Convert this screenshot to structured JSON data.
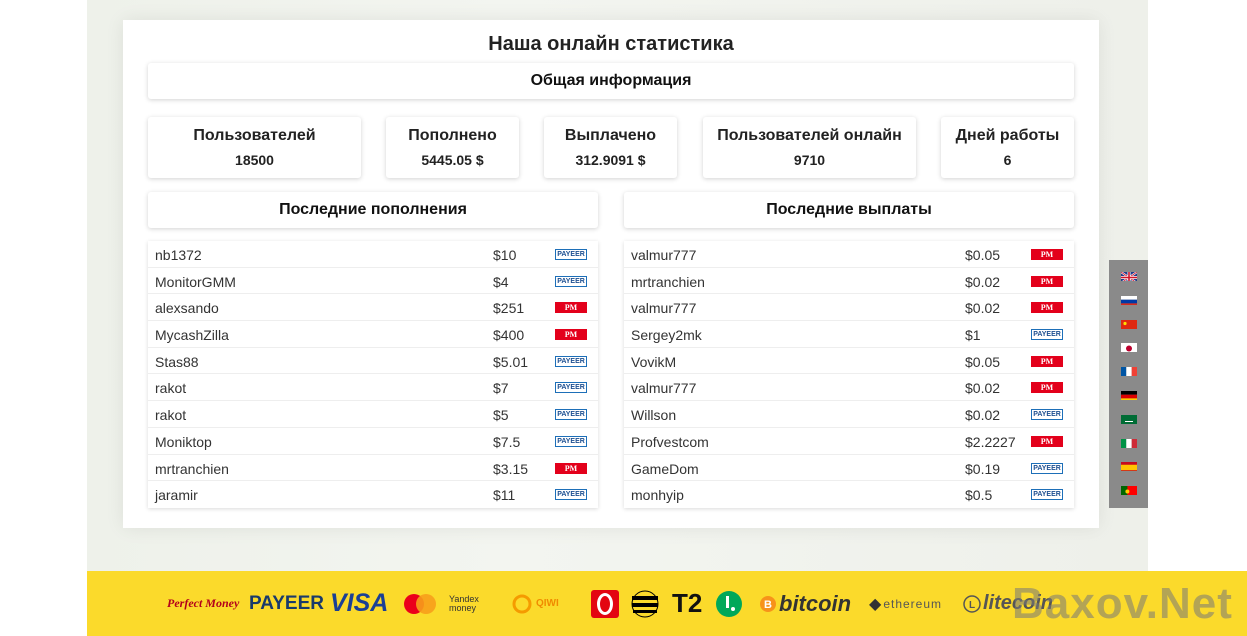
{
  "title": "Наша онлайн статистика",
  "general_info": "Общая информация",
  "stats": [
    {
      "label": "Пользователей",
      "value": "18500"
    },
    {
      "label": "Пополнено",
      "value": "5445.05 $"
    },
    {
      "label": "Выплачено",
      "value": "312.9091 $"
    },
    {
      "label": "Пользователей онлайн",
      "value": "9710"
    },
    {
      "label": "Дней работы",
      "value": "6"
    }
  ],
  "deposits": {
    "title": "Последние пополнения",
    "rows": [
      {
        "name": "nb1372",
        "amount": "$10",
        "system": "PAYEER"
      },
      {
        "name": "MonitorGMM",
        "amount": "$4",
        "system": "PAYEER"
      },
      {
        "name": "alexsando",
        "amount": "$251",
        "system": "PM"
      },
      {
        "name": "MycashZilla",
        "amount": "$400",
        "system": "PM"
      },
      {
        "name": "Stas88",
        "amount": "$5.01",
        "system": "PAYEER"
      },
      {
        "name": "rakot",
        "amount": "$7",
        "system": "PAYEER"
      },
      {
        "name": "rakot",
        "amount": "$5",
        "system": "PAYEER"
      },
      {
        "name": "Moniktop",
        "amount": "$7.5",
        "system": "PAYEER"
      },
      {
        "name": "mrtranchien",
        "amount": "$3.15",
        "system": "PM"
      },
      {
        "name": "jaramir",
        "amount": "$11",
        "system": "PAYEER"
      }
    ]
  },
  "payouts": {
    "title": "Последние выплаты",
    "rows": [
      {
        "name": "valmur777",
        "amount": "$0.05",
        "system": "PM"
      },
      {
        "name": "mrtranchien",
        "amount": "$0.02",
        "system": "PM"
      },
      {
        "name": "valmur777",
        "amount": "$0.02",
        "system": "PM"
      },
      {
        "name": "Sergey2mk",
        "amount": "$1",
        "system": "PAYEER"
      },
      {
        "name": "VovikM",
        "amount": "$0.05",
        "system": "PM"
      },
      {
        "name": "valmur777",
        "amount": "$0.02",
        "system": "PM"
      },
      {
        "name": "Willson",
        "amount": "$0.02",
        "system": "PAYEER"
      },
      {
        "name": "Profvestcom",
        "amount": "$2.2227",
        "system": "PM"
      },
      {
        "name": "GameDom",
        "amount": "$0.19",
        "system": "PAYEER"
      },
      {
        "name": "monhyip",
        "amount": "$0.5",
        "system": "PAYEER"
      }
    ]
  },
  "languages": [
    "flag-uk-icon",
    "flag-ru-icon",
    "flag-cn-icon",
    "flag-jp-icon",
    "flag-fr-icon",
    "flag-de-icon",
    "flag-sa-icon",
    "flag-it-icon",
    "flag-es-icon",
    "flag-pt-icon"
  ],
  "footer_logos": {
    "perfect_money": "Perfect Money",
    "payeer": "PAYEER",
    "visa": "VISA",
    "mastercard": "MasterCard",
    "yandex": "Yandex money",
    "qiwi": "QIWI",
    "t2": "T2",
    "bitcoin": "bitcoin",
    "ethereum": "ethereum",
    "litecoin": "litecoin"
  },
  "watermark": "Baxov.Net",
  "colors": {
    "footer": "#fbda2b",
    "pm": "#e3001b",
    "payeer": "#1d6fb8"
  }
}
